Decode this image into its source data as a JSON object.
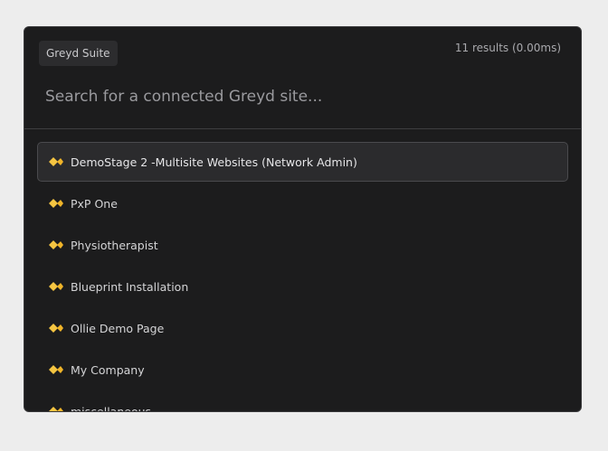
{
  "header": {
    "badge": "Greyd Suite",
    "results_count": "11 results (0.00ms)",
    "search_placeholder": "Search for a connected Greyd site..."
  },
  "items": [
    {
      "label": "DemoStage 2 -Multisite Websites (Network Admin)",
      "icon": "diamond-icon",
      "selected": true
    },
    {
      "label": "PxP One",
      "icon": "diamond-icon",
      "selected": false
    },
    {
      "label": "Physiotherapist",
      "icon": "diamond-icon",
      "selected": false
    },
    {
      "label": "Blueprint Installation",
      "icon": "diamond-icon",
      "selected": false
    },
    {
      "label": "Ollie Demo Page",
      "icon": "diamond-icon",
      "selected": false
    },
    {
      "label": "My Company",
      "icon": "diamond-icon",
      "selected": false
    },
    {
      "label": "miscellaneous",
      "icon": "diamond-icon",
      "selected": false
    }
  ],
  "colors": {
    "accent": "#f5c542",
    "panel": "#1c1c1d"
  }
}
